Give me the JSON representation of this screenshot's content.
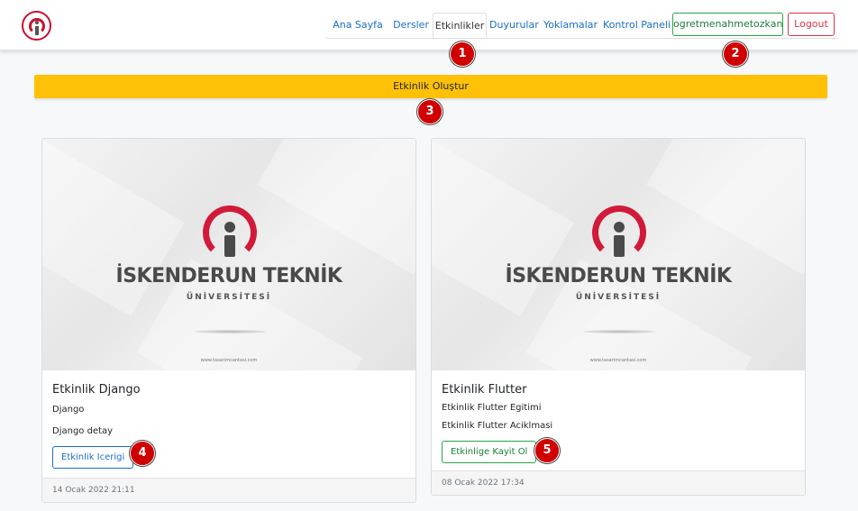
{
  "nav": {
    "items": [
      {
        "label": "Ana Sayfa"
      },
      {
        "label": "Dersler"
      },
      {
        "label": "Etkinlikler"
      },
      {
        "label": "Duyurular"
      },
      {
        "label": "Yoklamalar"
      },
      {
        "label": "Kontrol Paneli"
      }
    ],
    "active_item": "Etkinlikler",
    "user_label": "ogretmenahmetozkan",
    "logout_label": "Logout"
  },
  "create_button_label": "Etkinlik Oluştur",
  "badges": [
    "1",
    "2",
    "3",
    "4",
    "5"
  ],
  "cards": [
    {
      "image": {
        "name": "İSKENDERUN TEKNİK",
        "subtitle": "ÜNİVERSİTESİ",
        "url": "www.tasarimcantasi.com"
      },
      "title": "Etkinlik Django",
      "line1": "Django",
      "line2": "Django detay",
      "button_label": "Etkinlik Icerigi",
      "date": "14 Ocak 2022 21:11"
    },
    {
      "image": {
        "name": "İSKENDERUN TEKNİK",
        "subtitle": "ÜNİVERSİTESİ",
        "url": "www.tasarimcantasi.com"
      },
      "title": "Etkinlik Flutter",
      "line1": "Etkinlik Flutter Egitimi",
      "line2": "Etkinlik Flutter Aciklmasi",
      "button_label": "Etkinlige Kayit Ol",
      "date": "08 Ocak 2022 17:34"
    }
  ],
  "colors": {
    "primary": "#1a6fc9",
    "success": "#28a745",
    "danger": "#dc3545",
    "warning": "#ffc107",
    "badge": "#d10000",
    "brand_red": "#d11a3a"
  }
}
